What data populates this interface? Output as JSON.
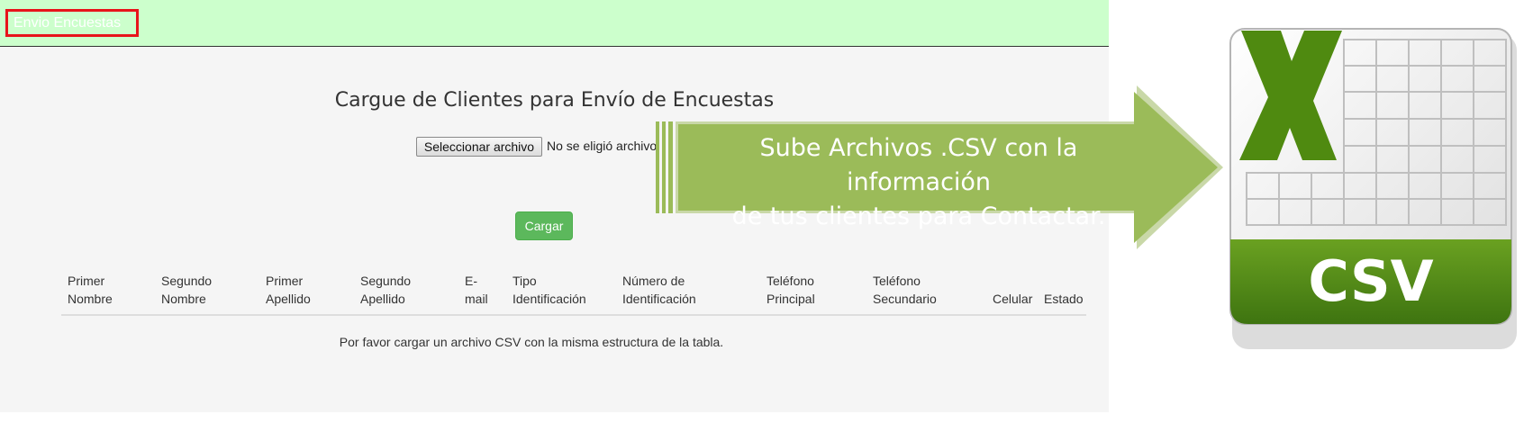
{
  "header": {
    "brand": "Envio Encuestas"
  },
  "page": {
    "title": "Cargue de Clientes para Envío de Encuestas",
    "file_button_label": "Seleccionar archivo",
    "file_status": "No se eligió archivo",
    "upload_button_label": "Cargar",
    "table": {
      "columns": [
        [
          "Primer",
          "Nombre"
        ],
        [
          "Segundo",
          "Nombre"
        ],
        [
          "Primer",
          "Apellido"
        ],
        [
          "Segundo",
          "Apellido"
        ],
        [
          "E-",
          "mail"
        ],
        [
          "Tipo",
          "Identificación"
        ],
        [
          "Número de",
          "Identificación"
        ],
        [
          "Teléfono",
          "Principal"
        ],
        [
          "Teléfono",
          "Secundario"
        ],
        [
          "",
          "Celular"
        ],
        [
          "",
          "Estado"
        ]
      ],
      "empty_message": "Por favor cargar un archivo CSV con la misma estructura de la tabla."
    }
  },
  "callout": {
    "line1": "Sube Archivos .CSV con la información",
    "line2": "de tus clientes para Contactar."
  },
  "csv_icon": {
    "label": "CSV"
  },
  "colors": {
    "topbar": "#ccffcc",
    "brand_border": "#e8141b",
    "upload_button": "#5cb85c",
    "arrow": "#9bbb59",
    "csv_green": "#4f8a10"
  }
}
